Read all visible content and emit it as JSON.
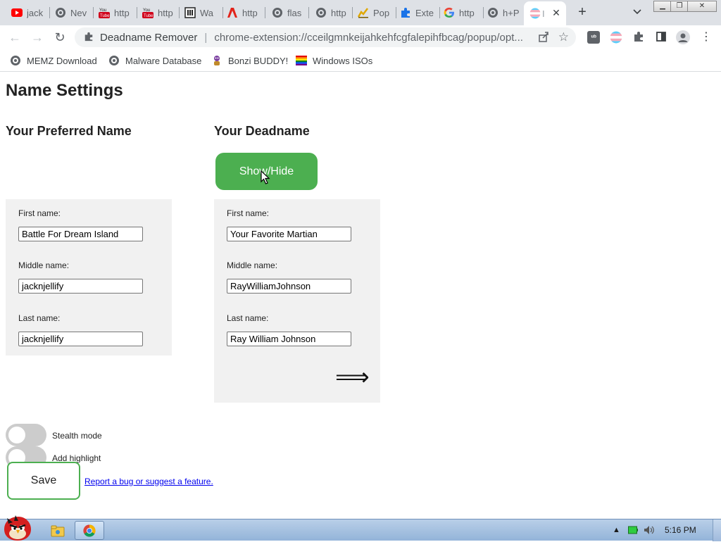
{
  "browser": {
    "tabs": [
      {
        "label": "jack",
        "icon": "youtube-icon"
      },
      {
        "label": "Nev",
        "icon": "globe-icon"
      },
      {
        "label": "http",
        "icon": "youtube-icon"
      },
      {
        "label": "http",
        "icon": "youtube-icon"
      },
      {
        "label": "Wa",
        "icon": "archive-icon"
      },
      {
        "label": "http",
        "icon": "adobe-icon"
      },
      {
        "label": "flas",
        "icon": "globe-icon"
      },
      {
        "label": "http",
        "icon": "globe-icon"
      },
      {
        "label": "Pop",
        "icon": "chart-icon"
      },
      {
        "label": "Exte",
        "icon": "puzzle-icon"
      },
      {
        "label": "http",
        "icon": "google-icon"
      },
      {
        "label": "h+P",
        "icon": "globe-icon"
      },
      {
        "label": "I",
        "icon": "trans-flag-icon",
        "active": true
      }
    ],
    "omnibox": {
      "site_name": "Deadname Remover",
      "divider": "|",
      "url": "chrome-extension://cceilgmnkeijahkehfcgfalepihfbcag/popup/opt..."
    },
    "bookmarks": [
      {
        "label": "MEMZ Download",
        "icon": "globe-icon"
      },
      {
        "label": "Malware Database",
        "icon": "globe-icon"
      },
      {
        "label": "Bonzi BUDDY!",
        "icon": "bonzi-icon"
      },
      {
        "label": "Windows ISOs",
        "icon": "rainbow-flag-icon"
      }
    ]
  },
  "page": {
    "title": "Name Settings",
    "preferred": {
      "heading": "Your Preferred Name",
      "first_label": "First name:",
      "first_value": "Battle For Dream Island",
      "middle_label": "Middle name:",
      "middle_value": "jacknjellify",
      "last_label": "Last name:",
      "last_value": "jacknjellify"
    },
    "deadname": {
      "heading": "Your Deadname",
      "show_hide_label": "Show/Hide",
      "first_label": "First name:",
      "first_value": "Your Favorite Martian",
      "middle_label": "Middle name:",
      "middle_value": "RayWilliamJohnson",
      "last_label": "Last name:",
      "last_value": "Ray William Johnson",
      "arrow_glyph": "⟹"
    },
    "stealth_label": "Stealth mode",
    "highlight_label": "Add highlight",
    "save_label": "Save",
    "report_link": "Report a bug or suggest a feature."
  },
  "taskbar": {
    "clock": "5:16 PM"
  },
  "colors": {
    "accent_green": "#4caf50",
    "panel_bg": "#f1f1f1",
    "link": "#0000ee"
  }
}
